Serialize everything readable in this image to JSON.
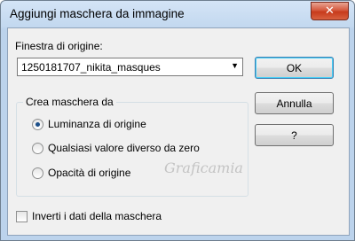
{
  "window": {
    "title": "Aggiungi maschera da immagine"
  },
  "source": {
    "label": "Finestra di origine:",
    "selected": "1250181707_nikita_masques"
  },
  "buttons": {
    "ok": "OK",
    "cancel": "Annulla",
    "help": "?"
  },
  "group": {
    "title": "Crea maschera da",
    "options": [
      {
        "label": "Luminanza di origine",
        "checked": true
      },
      {
        "label": "Qualsiasi valore diverso da zero",
        "checked": false
      },
      {
        "label": "Opacità di origine",
        "checked": false
      }
    ]
  },
  "invert": {
    "label": "Inverti i dati della maschera",
    "checked": false
  },
  "watermark": {
    "text": "Graficamia"
  },
  "colors": {
    "close_button": "#c73a1c",
    "title_gradient": "#c2d8ef",
    "dialog_bg": "#f0f0f0"
  }
}
